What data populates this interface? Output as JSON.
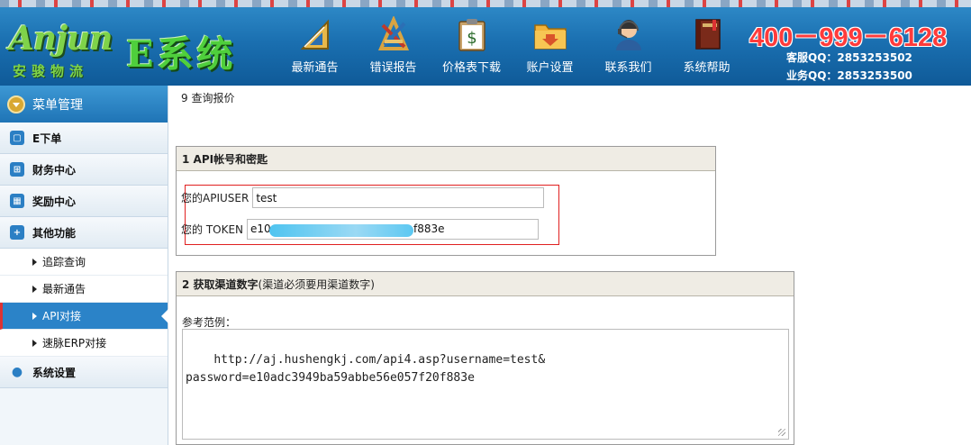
{
  "header": {
    "logo_en": "Anjun",
    "logo_cn": "安骏物流",
    "system_title": "E系统",
    "nav": [
      {
        "label": "最新通告",
        "icon": "notice-icon"
      },
      {
        "label": "错误报告",
        "icon": "error-report-icon"
      },
      {
        "label": "价格表下载",
        "icon": "price-list-icon"
      },
      {
        "label": "账户设置",
        "icon": "account-folder-icon"
      },
      {
        "label": "联系我们",
        "icon": "support-agent-icon"
      },
      {
        "label": "系统帮助",
        "icon": "help-book-icon"
      }
    ],
    "phone": "400－999－6128",
    "service_qq": "客服QQ：2853253502",
    "business_qq": "业务QQ：2853253500"
  },
  "sidebar": {
    "title": "菜单管理",
    "items": [
      {
        "label": "E下单",
        "icon": "order-icon"
      },
      {
        "label": "财务中心",
        "icon": "cart-icon"
      },
      {
        "label": "奖励中心",
        "icon": "calendar-icon"
      },
      {
        "label": "其他功能",
        "icon": "plus-box-icon"
      }
    ],
    "sub_items": [
      {
        "label": "追踪查询"
      },
      {
        "label": "最新通告"
      },
      {
        "label": "API对接"
      },
      {
        "label": "速脉ERP对接"
      }
    ],
    "settings": {
      "label": "系统设置",
      "icon": "user-icon"
    }
  },
  "main": {
    "breadcrumb": "9 查询报价",
    "section1": {
      "title": "1 API帐号和密匙",
      "apiuser_label": "您的APIUSER",
      "apiuser_value": "test",
      "token_label": "您的 TOKEN",
      "token_head": "e10",
      "token_tail": "f883e"
    },
    "section2": {
      "title": "2 获取渠道数字",
      "title_note": "(渠道必须要用渠道数字)",
      "ref_label": "参考范例：",
      "example": "http://aj.hushengkj.com/api4.asp?username=test&\npassword=e10adc3949ba59abbe56e057f20f883e"
    }
  },
  "colors": {
    "header_blue": "#1a6fb0",
    "accent_green": "#4fcf3c",
    "phone_red": "#ff3b3b",
    "highlight_red": "#e02020",
    "active_blue": "#2b83c8"
  }
}
